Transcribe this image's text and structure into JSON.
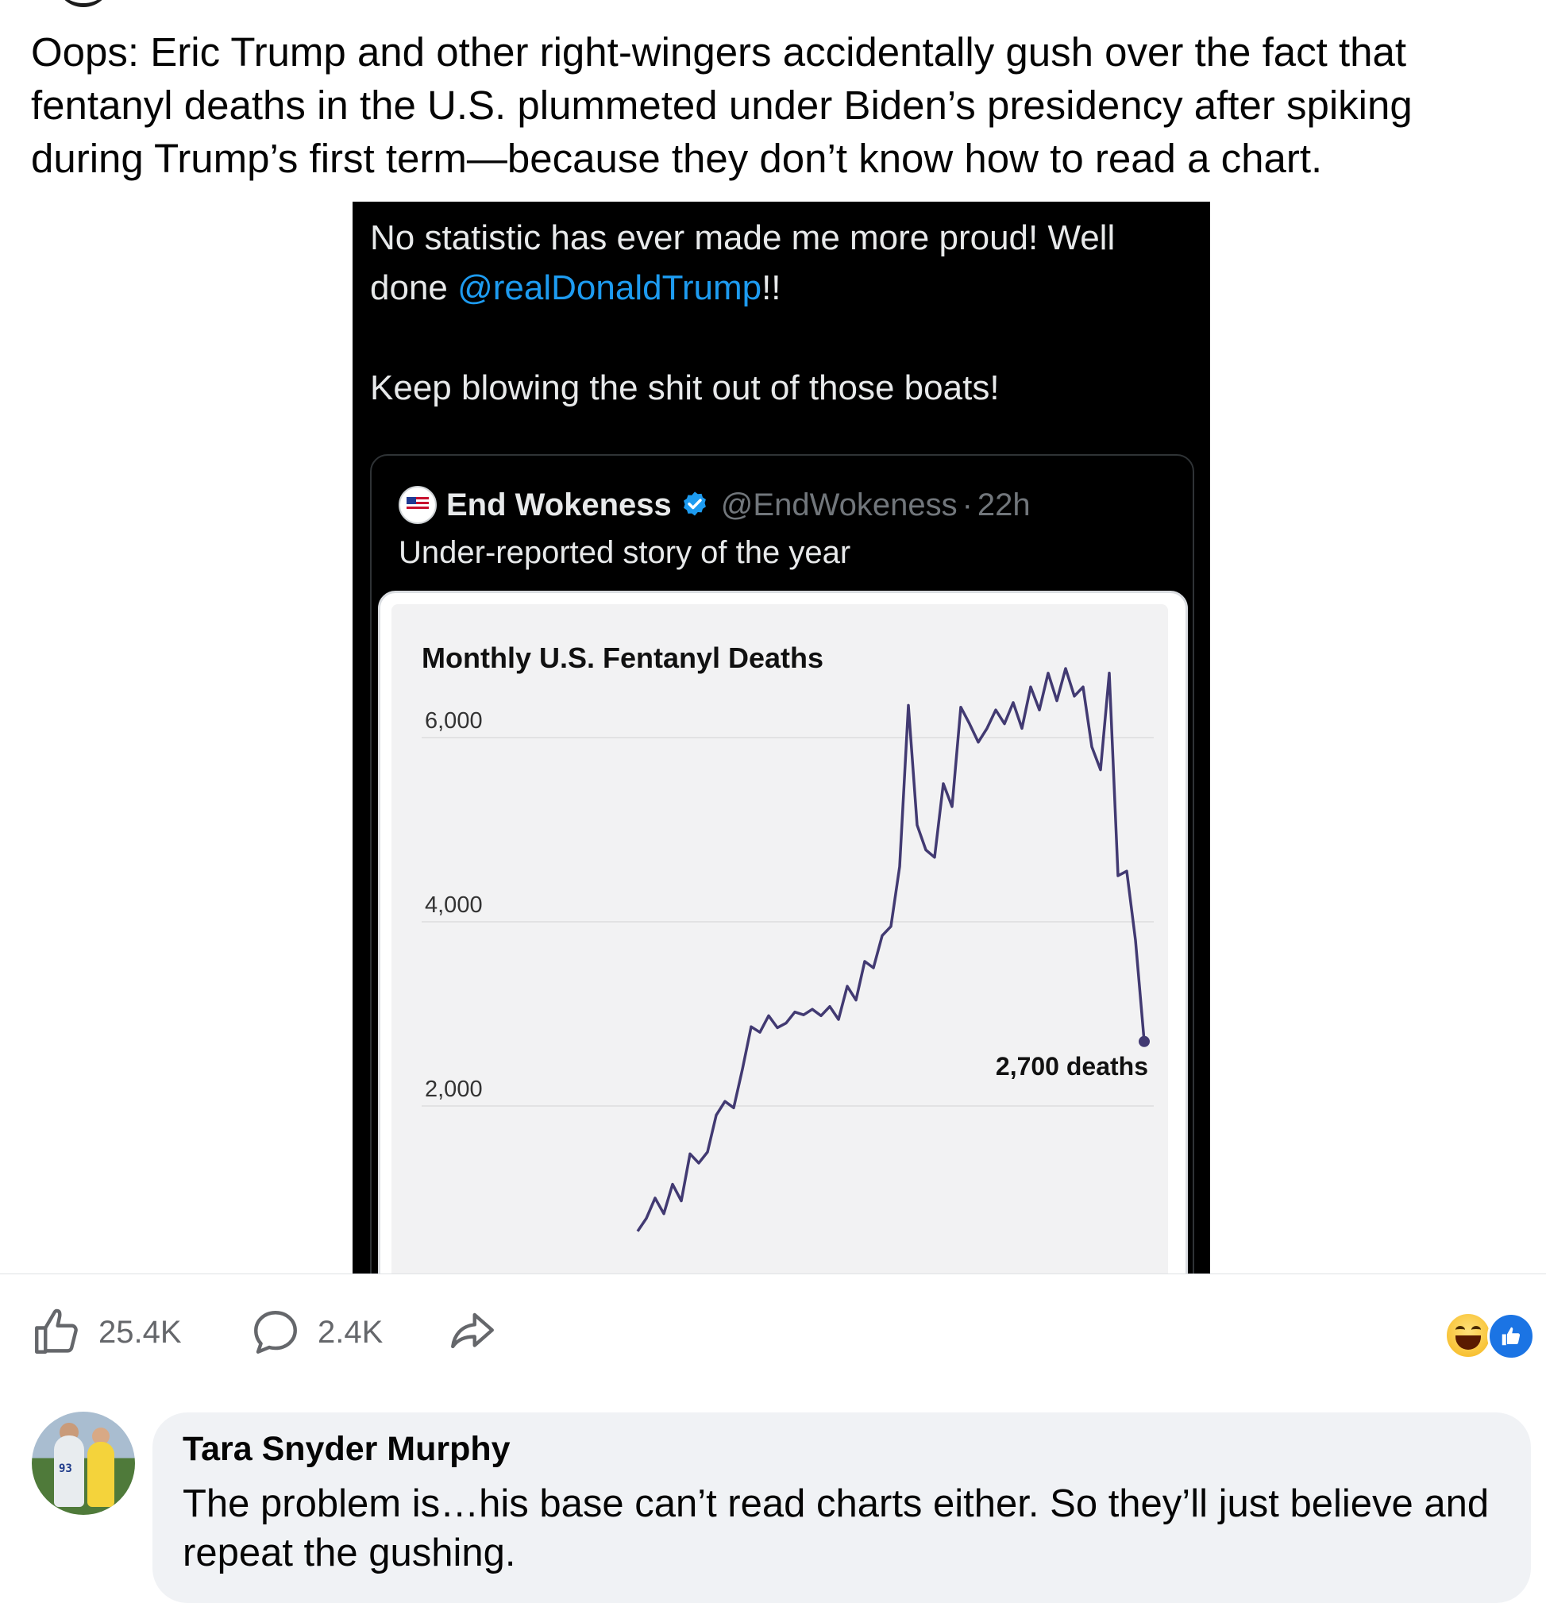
{
  "post": {
    "text": "Oops: Eric Trump and other right-wingers accidentally gush over the fact that fentanyl deaths in the U.S. plummeted under Biden’s presidency after spiking during Trump’s first term—because they don’t know how to read a chart."
  },
  "tweet": {
    "line1": "No statistic has ever made me more proud! Well",
    "line2_prefix": "done ",
    "mention": "@realDonaldTrump",
    "line2_suffix": "!!",
    "line3": "Keep blowing the shit out of those boats!",
    "quote": {
      "name": "End Wokeness",
      "handle": "@EndWokeness",
      "separator": "·",
      "time": "22h",
      "text": "Under-reported story of the year"
    }
  },
  "chart_data": {
    "type": "line",
    "title": "Monthly U.S. Fentanyl Deaths",
    "xlabel": "",
    "ylabel": "",
    "yticks": [
      "6,000",
      "4,000",
      "2,000"
    ],
    "ylim": [
      700,
      7000
    ],
    "grid": true,
    "annotation": "2,700 deaths",
    "series": [
      {
        "values": [
          640,
          780,
          1000,
          830,
          1150,
          970,
          1480,
          1380,
          1500,
          1900,
          2050,
          1980,
          2400,
          2860,
          2800,
          2980,
          2850,
          2900,
          3020,
          2990,
          3050,
          2980,
          3080,
          2940,
          3300,
          3150,
          3570,
          3500,
          3850,
          3950,
          4600,
          6350,
          5050,
          4780,
          4700,
          5500,
          5250,
          6330,
          6150,
          5950,
          6100,
          6300,
          6150,
          6380,
          6100,
          6550,
          6300,
          6700,
          6400,
          6750,
          6450,
          6550,
          5900,
          5650,
          6700,
          4500,
          4550,
          3800,
          2700
        ],
        "color": "#423a72"
      }
    ]
  },
  "actions": {
    "likes": "25.4K",
    "comments": "2.4K"
  },
  "comment": {
    "author": "Tara Snyder Murphy",
    "text": "The problem is…his base can’t read charts either. So they’ll just believe and repeat the gushing."
  },
  "icons": {
    "like": "thumbs-up-icon",
    "comment": "speech-bubble-icon",
    "share": "share-arrow-icon",
    "verified": "verified-badge-icon"
  },
  "colors": {
    "mention": "#1d9bf0",
    "verified": "#1d9bf0",
    "like_reaction": "#1b74e4",
    "chart_line": "#423a72",
    "comment_bubble": "#f0f2f5"
  }
}
